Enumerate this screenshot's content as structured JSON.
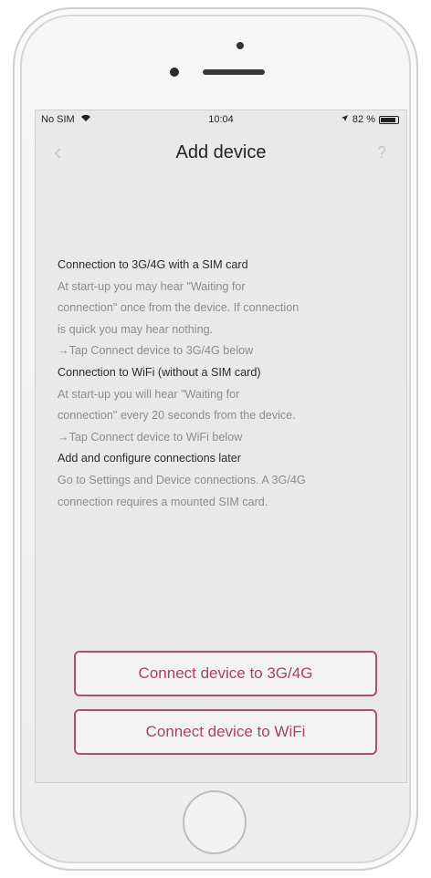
{
  "status_bar": {
    "carrier": "No SIM",
    "time": "10:04",
    "battery": "82 %"
  },
  "nav": {
    "back_icon": "chevron-left-icon",
    "title": "Add device",
    "help": "?"
  },
  "info": {
    "lines": [
      "Connection to 3G/4G with a SIM card",
      "At start-up you may hear \"Waiting for",
      "connection\" once from the device. If connection",
      "is quick you may hear nothing.",
      "→Tap Connect device to 3G/4G below",
      "Connection to WiFi (without a SIM card)",
      "At start-up you will hear \"Waiting for",
      "connection\" every 20 seconds from the device.",
      "→Tap Connect device to WiFi below",
      "Add and configure connections later",
      "Go to Settings and Device connections. A 3G/4G",
      "connection requires a mounted SIM card."
    ]
  },
  "buttons": {
    "connect_3g": "Connect device to 3G/4G",
    "connect_wifi": "Connect device to WiFi"
  },
  "colors": {
    "accent": "#b0506b",
    "background": "#e9e9e9"
  }
}
